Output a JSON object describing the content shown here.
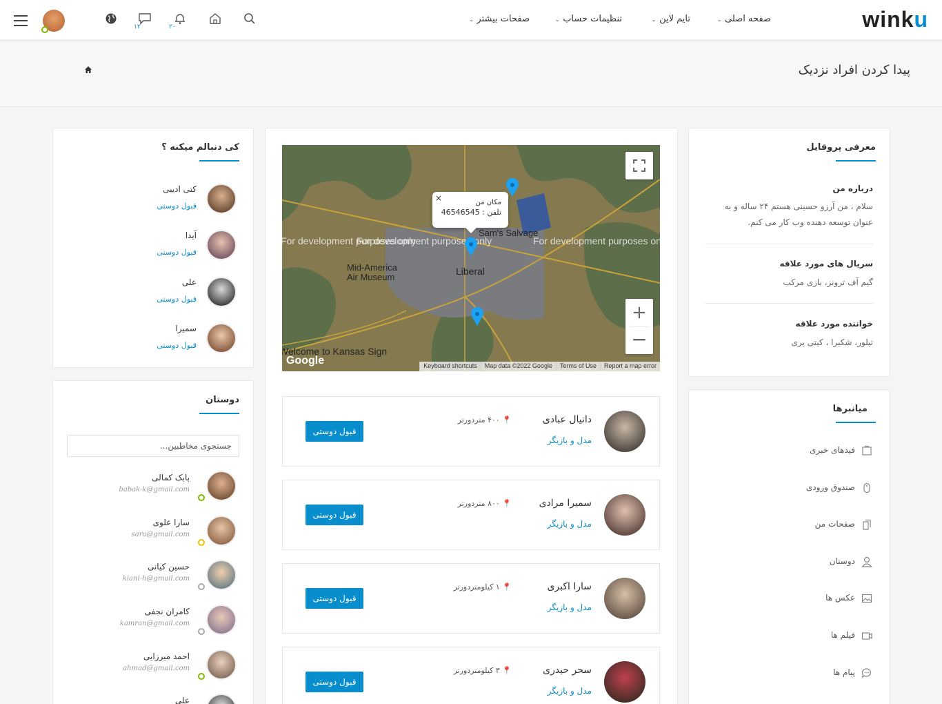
{
  "app": {
    "logo": "winku"
  },
  "topnav": {
    "items": [
      "صفحه اصلی",
      "تایم لاین",
      "تنظیمات حساب",
      "صفحات بیشتر"
    ],
    "badges": {
      "messages": "۱۲",
      "notifications": "۲۰"
    }
  },
  "header": {
    "title": "پیدا کردن افراد نزدیک"
  },
  "followers": {
    "title": "کی دنبالم میکنه ؟",
    "people": [
      {
        "name": "کتی ادیبی",
        "action": "قبول دوستی"
      },
      {
        "name": "آیدا",
        "action": "قبول دوستی"
      },
      {
        "name": "علی",
        "action": "قبول دوستی"
      },
      {
        "name": "سمیرا",
        "action": "قبول دوستی"
      }
    ]
  },
  "friends": {
    "title": "دوستان",
    "search_placeholder": "جستجوی مخاطبین...",
    "people": [
      {
        "name": "بابک کمالی",
        "email": "babak-k@gmail.com",
        "status": "#7fba00"
      },
      {
        "name": "سارا علوی",
        "email": "sara@gmail.com",
        "status": "#f0c000"
      },
      {
        "name": "حسین کیانی",
        "email": "kiani-h@gmail.com",
        "status": "#aaaaaa"
      },
      {
        "name": "کامران نجفی",
        "email": "kamran@gmail.com",
        "status": "#aaaaaa"
      },
      {
        "name": "احمد میرزایی",
        "email": "ahmad@gmail.com",
        "status": "#7fba00"
      },
      {
        "name": "علی",
        "email": "",
        "status": "#aaaaaa"
      }
    ]
  },
  "map": {
    "popup_title": "مکان من",
    "popup_phone": "تلفن : 46546545",
    "watermark": "For development purposes only",
    "labels": {
      "city": "Liberal",
      "museum": "Mid-America Air Museum",
      "salvage": "Sam's Salvage",
      "sign": "Welcome to Kansas Sign"
    },
    "footer": [
      "Keyboard shortcuts",
      "Map data ©2022 Google",
      "Terms of Use",
      "Report a map error"
    ],
    "google": "Google"
  },
  "nearby": [
    {
      "name": "دانیال عبادی",
      "role": "مدل و بازیگر",
      "distance": "۴۰۰ متردورتر",
      "action": "قبول دوستی"
    },
    {
      "name": "سمیرا مرادی",
      "role": "مدل و بازیگر",
      "distance": "۸۰۰ متردورتر",
      "action": "قبول دوستی"
    },
    {
      "name": "سارا اکبری",
      "role": "مدل و بازیگر",
      "distance": "۱ کیلومتردورتر",
      "action": "قبول دوستی"
    },
    {
      "name": "سحر حیدری",
      "role": "مدل و بازیگر",
      "distance": "۳ کیلومتردورتر",
      "action": "قبول دوستی"
    }
  ],
  "profile": {
    "title": "معرفی پروفایل",
    "about_title": "درباره من",
    "about_text": "سلام ، من آرزو حسینی هستم ۲۴ ساله و به عنوان توسعه دهنده وب کار می کنم.",
    "series_title": "سریال های مورد علاقه",
    "series_text": "گیم آف ترونز، بازی مرکب",
    "singers_title": "خواننده مورد علاقه",
    "singers_text": "تیلور، شکیرا ، کیتی پری"
  },
  "shortcuts": {
    "title": "میانبرها",
    "items": [
      {
        "label": "فیدهای خبری",
        "icon": "news-feed-icon"
      },
      {
        "label": "صندوق ورودی",
        "icon": "mouse-icon"
      },
      {
        "label": "صفحات من",
        "icon": "pages-icon"
      },
      {
        "label": "دوستان",
        "icon": "user-icon"
      },
      {
        "label": "عکس ها",
        "icon": "image-icon"
      },
      {
        "label": "فیلم ها",
        "icon": "video-icon"
      },
      {
        "label": "پیام ها",
        "icon": "chat-icon"
      }
    ]
  },
  "colors": {
    "accent": "#088dcd"
  }
}
